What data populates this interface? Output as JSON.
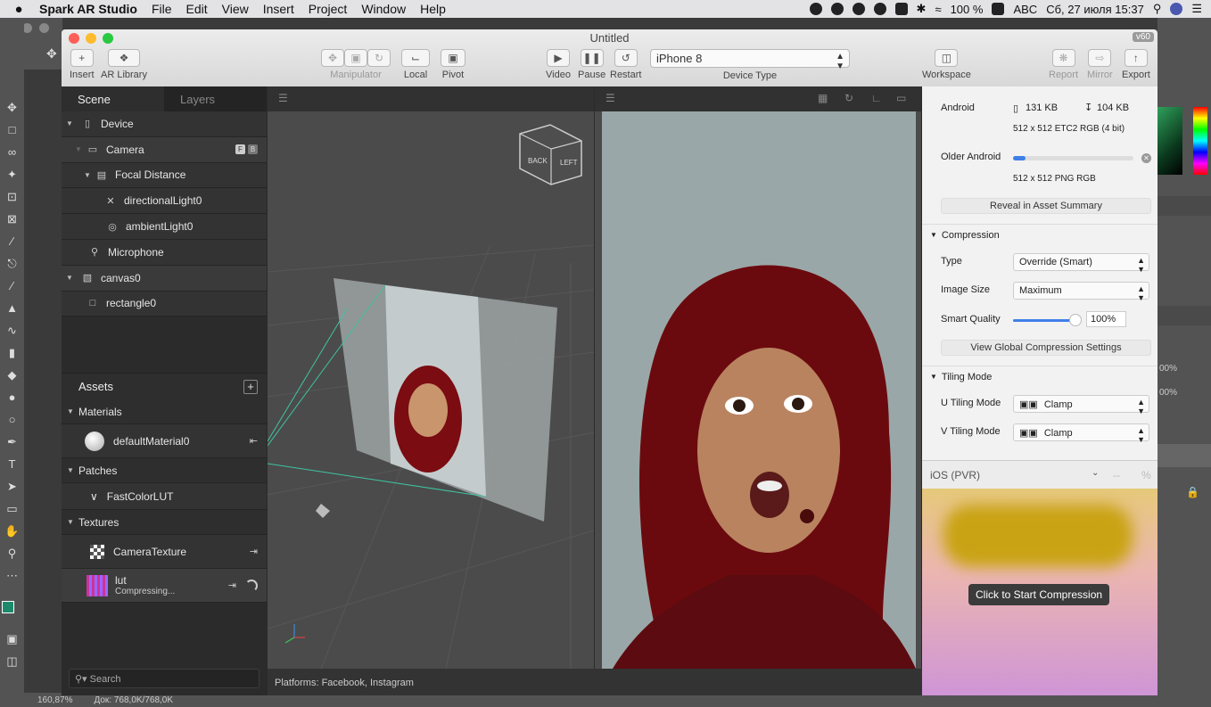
{
  "menubar": {
    "app": "Spark AR Studio",
    "items": [
      "File",
      "Edit",
      "View",
      "Insert",
      "Project",
      "Window",
      "Help"
    ],
    "battery": "100 %",
    "input": "ABC",
    "datetime": "Сб, 27 июля  15:37"
  },
  "photoshop": {
    "zoom": "160,87%",
    "doc": "Док: 768,0K/768,0K",
    "percent1": "00%",
    "percent2": "00%"
  },
  "window": {
    "title": "Untitled",
    "version": "v60"
  },
  "toolbar": {
    "insert": "Insert",
    "ar_library": "AR Library",
    "manipulator": "Manipulator",
    "local": "Local",
    "pivot": "Pivot",
    "video": "Video",
    "pause": "Pause",
    "restart": "Restart",
    "device_value": "iPhone 8",
    "device_type": "Device Type",
    "workspace": "Workspace",
    "report": "Report",
    "mirror": "Mirror",
    "export": "Export"
  },
  "scene": {
    "tab_scene": "Scene",
    "tab_layers": "Layers",
    "items": [
      {
        "label": "Device"
      },
      {
        "label": "Camera",
        "f": "F",
        "b": "B"
      },
      {
        "label": "Focal Distance"
      },
      {
        "label": "directionalLight0"
      },
      {
        "label": "ambientLight0"
      },
      {
        "label": "Microphone"
      },
      {
        "label": "canvas0"
      },
      {
        "label": "rectangle0"
      }
    ]
  },
  "assets": {
    "title": "Assets",
    "materials": "Materials",
    "default_material": "defaultMaterial0",
    "patches": "Patches",
    "fast_color_lut": "FastColorLUT",
    "textures": "Textures",
    "camera_texture": "CameraTexture",
    "lut": "lut",
    "lut_status": "Compressing...",
    "search_placeholder": "Search"
  },
  "viewport": {
    "cube_back": "BACK",
    "cube_left": "LEFT"
  },
  "status": {
    "platforms": "Platforms: Facebook, Instagram"
  },
  "inspector": {
    "android": "Android",
    "android_size1": "131 KB",
    "android_size2": "104 KB",
    "android_format": "512 x 512 ETC2 RGB (4 bit)",
    "older_android": "Older Android",
    "older_progress": 0.1,
    "older_format": "512 x 512 PNG RGB",
    "reveal": "Reveal in Asset Summary",
    "compression": "Compression",
    "type_label": "Type",
    "type_value": "Override (Smart)",
    "image_size_label": "Image Size",
    "image_size_value": "Maximum",
    "smart_quality_label": "Smart Quality",
    "smart_quality_value": "100%",
    "smart_quality_level": 1.0,
    "view_global": "View Global Compression Settings",
    "tiling_mode": "Tiling Mode",
    "u_tiling_label": "U Tiling Mode",
    "u_tiling_value": "Clamp",
    "v_tiling_label": "V Tiling Mode",
    "v_tiling_value": "Clamp",
    "ios": "iOS (PVR)",
    "ios_dash": "--",
    "ios_pct": "%",
    "start_compression": "Click to Start Compression"
  },
  "colors": {
    "accent": "#3f7fe8",
    "panel_dark": "#2b2b2b",
    "inspector_bg": "#f2f2f2",
    "hair_red": "#6b0a0e"
  }
}
